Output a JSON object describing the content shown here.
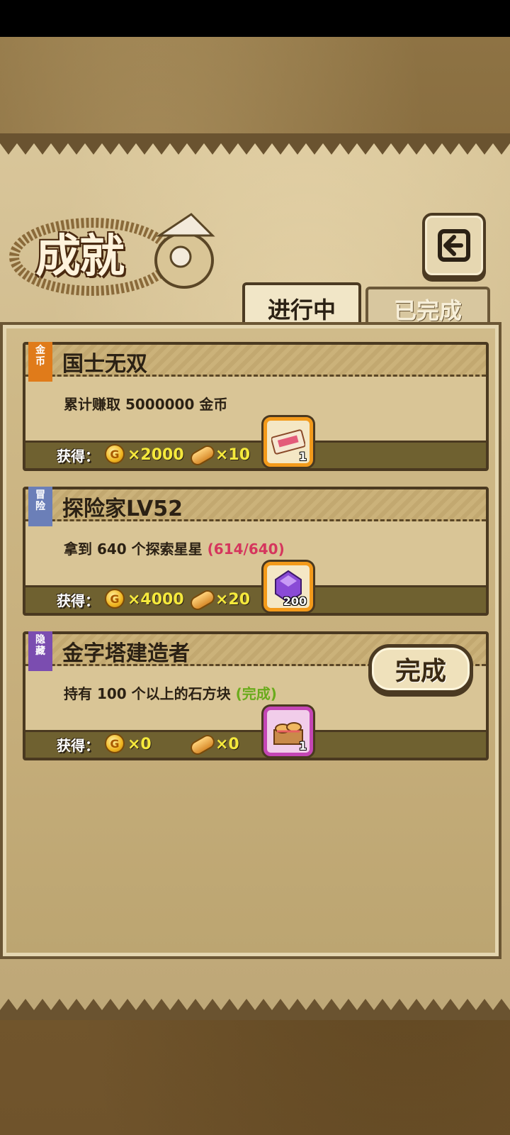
{
  "header": {
    "title": "成就",
    "back_icon": "back-arrow-icon"
  },
  "tabs": [
    {
      "label": "进行中",
      "active": true
    },
    {
      "label": "已完成",
      "active": false
    }
  ],
  "achievements": [
    {
      "badge": "金币",
      "badge_color": "#e07b1a",
      "name": "国士无双",
      "desc": "累计赚取 5000000 金币",
      "progress": "",
      "gain_label": "获得：",
      "coin_amount": "×2000",
      "bread_amount": "×10",
      "item_icon": "ticket-icon",
      "item_count": "1"
    },
    {
      "badge": "冒险",
      "badge_color": "#6b7fb8",
      "name": "探险家LV52",
      "desc": "拿到 640 个探索星星",
      "progress": "(614/640)",
      "gain_label": "获得：",
      "coin_amount": "×4000",
      "bread_amount": "×20",
      "item_icon": "gem-icon",
      "item_count": "200"
    },
    {
      "badge": "隐藏",
      "badge_color": "#7b4db0",
      "name": "金字塔建造者",
      "desc": "持有 100 个以上的石方块",
      "progress": "(完成)",
      "gain_label": "获得：",
      "coin_amount": "×0",
      "bread_amount": "×0",
      "item_icon": "bread-basket-icon",
      "item_count": "1",
      "button_label": "完成"
    }
  ],
  "colors": {
    "progress_red": "#d5365d",
    "progress_green": "#6aab1c",
    "amount_yellow": "#f5e93c"
  }
}
